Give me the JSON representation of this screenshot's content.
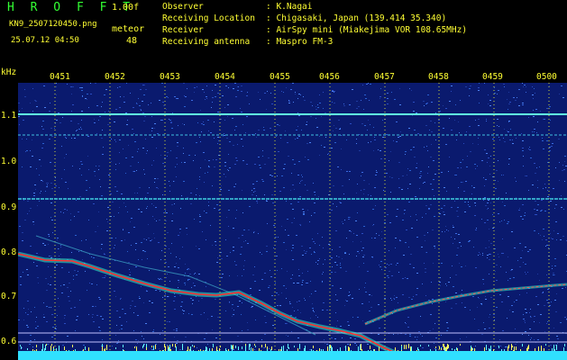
{
  "header": {
    "title": "H R O F F T",
    "version": "1.00f",
    "filename": "KN9_2507120450.png",
    "datetime": "25.07.12 04:50",
    "meteor_label": "meteor",
    "meteor_count": "48",
    "observer_key": "Observer",
    "observer_val": ": K.Nagai",
    "location_key": "Receiving Location",
    "location_val": ": Chigasaki, Japan (139.414 35.340)",
    "receiver_key": "Receiver",
    "receiver_val": ": AirSpy mini (Miakejima VOR 108.65MHz)",
    "antenna_key": "Receiving antenna",
    "antenna_val": ": Maspro FM-3"
  },
  "axis": {
    "unit": "kHz",
    "times": [
      "0451",
      "0452",
      "0453",
      "0454",
      "0455",
      "0456",
      "0457",
      "0458",
      "0459",
      "0500"
    ],
    "freqs": [
      "1.1",
      "1.0",
      "0.9",
      "0.8",
      "0.7",
      "0.6"
    ]
  },
  "colors": {
    "text": "#ffff33",
    "title": "#33ff33",
    "background": "#0a1a6e",
    "trace": "#ff3030"
  }
}
